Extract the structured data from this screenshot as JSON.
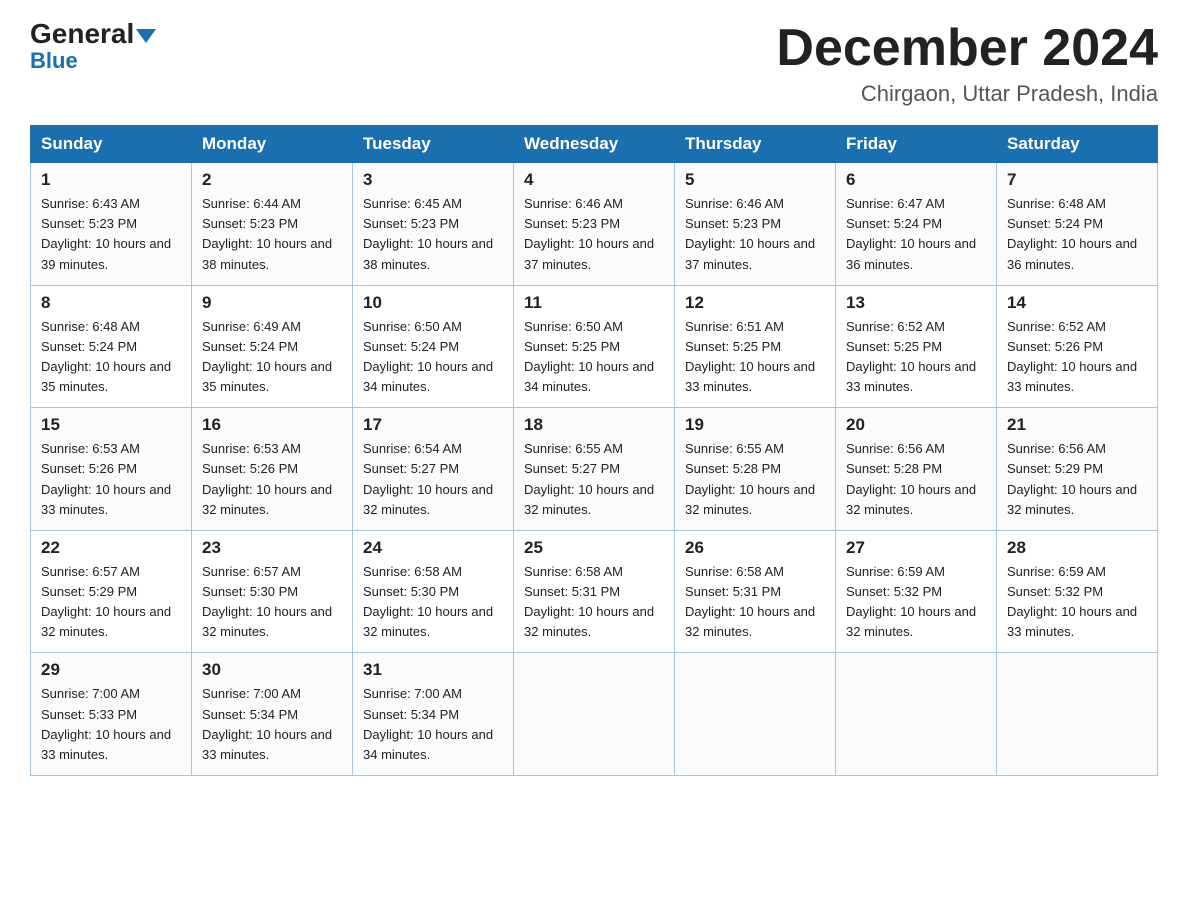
{
  "header": {
    "logo_general": "General",
    "logo_blue": "Blue",
    "month_title": "December 2024",
    "location": "Chirgaon, Uttar Pradesh, India"
  },
  "weekdays": [
    "Sunday",
    "Monday",
    "Tuesday",
    "Wednesday",
    "Thursday",
    "Friday",
    "Saturday"
  ],
  "weeks": [
    [
      {
        "day": "1",
        "sunrise": "6:43 AM",
        "sunset": "5:23 PM",
        "daylight": "10 hours and 39 minutes."
      },
      {
        "day": "2",
        "sunrise": "6:44 AM",
        "sunset": "5:23 PM",
        "daylight": "10 hours and 38 minutes."
      },
      {
        "day": "3",
        "sunrise": "6:45 AM",
        "sunset": "5:23 PM",
        "daylight": "10 hours and 38 minutes."
      },
      {
        "day": "4",
        "sunrise": "6:46 AM",
        "sunset": "5:23 PM",
        "daylight": "10 hours and 37 minutes."
      },
      {
        "day": "5",
        "sunrise": "6:46 AM",
        "sunset": "5:23 PM",
        "daylight": "10 hours and 37 minutes."
      },
      {
        "day": "6",
        "sunrise": "6:47 AM",
        "sunset": "5:24 PM",
        "daylight": "10 hours and 36 minutes."
      },
      {
        "day": "7",
        "sunrise": "6:48 AM",
        "sunset": "5:24 PM",
        "daylight": "10 hours and 36 minutes."
      }
    ],
    [
      {
        "day": "8",
        "sunrise": "6:48 AM",
        "sunset": "5:24 PM",
        "daylight": "10 hours and 35 minutes."
      },
      {
        "day": "9",
        "sunrise": "6:49 AM",
        "sunset": "5:24 PM",
        "daylight": "10 hours and 35 minutes."
      },
      {
        "day": "10",
        "sunrise": "6:50 AM",
        "sunset": "5:24 PM",
        "daylight": "10 hours and 34 minutes."
      },
      {
        "day": "11",
        "sunrise": "6:50 AM",
        "sunset": "5:25 PM",
        "daylight": "10 hours and 34 minutes."
      },
      {
        "day": "12",
        "sunrise": "6:51 AM",
        "sunset": "5:25 PM",
        "daylight": "10 hours and 33 minutes."
      },
      {
        "day": "13",
        "sunrise": "6:52 AM",
        "sunset": "5:25 PM",
        "daylight": "10 hours and 33 minutes."
      },
      {
        "day": "14",
        "sunrise": "6:52 AM",
        "sunset": "5:26 PM",
        "daylight": "10 hours and 33 minutes."
      }
    ],
    [
      {
        "day": "15",
        "sunrise": "6:53 AM",
        "sunset": "5:26 PM",
        "daylight": "10 hours and 33 minutes."
      },
      {
        "day": "16",
        "sunrise": "6:53 AM",
        "sunset": "5:26 PM",
        "daylight": "10 hours and 32 minutes."
      },
      {
        "day": "17",
        "sunrise": "6:54 AM",
        "sunset": "5:27 PM",
        "daylight": "10 hours and 32 minutes."
      },
      {
        "day": "18",
        "sunrise": "6:55 AM",
        "sunset": "5:27 PM",
        "daylight": "10 hours and 32 minutes."
      },
      {
        "day": "19",
        "sunrise": "6:55 AM",
        "sunset": "5:28 PM",
        "daylight": "10 hours and 32 minutes."
      },
      {
        "day": "20",
        "sunrise": "6:56 AM",
        "sunset": "5:28 PM",
        "daylight": "10 hours and 32 minutes."
      },
      {
        "day": "21",
        "sunrise": "6:56 AM",
        "sunset": "5:29 PM",
        "daylight": "10 hours and 32 minutes."
      }
    ],
    [
      {
        "day": "22",
        "sunrise": "6:57 AM",
        "sunset": "5:29 PM",
        "daylight": "10 hours and 32 minutes."
      },
      {
        "day": "23",
        "sunrise": "6:57 AM",
        "sunset": "5:30 PM",
        "daylight": "10 hours and 32 minutes."
      },
      {
        "day": "24",
        "sunrise": "6:58 AM",
        "sunset": "5:30 PM",
        "daylight": "10 hours and 32 minutes."
      },
      {
        "day": "25",
        "sunrise": "6:58 AM",
        "sunset": "5:31 PM",
        "daylight": "10 hours and 32 minutes."
      },
      {
        "day": "26",
        "sunrise": "6:58 AM",
        "sunset": "5:31 PM",
        "daylight": "10 hours and 32 minutes."
      },
      {
        "day": "27",
        "sunrise": "6:59 AM",
        "sunset": "5:32 PM",
        "daylight": "10 hours and 32 minutes."
      },
      {
        "day": "28",
        "sunrise": "6:59 AM",
        "sunset": "5:32 PM",
        "daylight": "10 hours and 33 minutes."
      }
    ],
    [
      {
        "day": "29",
        "sunrise": "7:00 AM",
        "sunset": "5:33 PM",
        "daylight": "10 hours and 33 minutes."
      },
      {
        "day": "30",
        "sunrise": "7:00 AM",
        "sunset": "5:34 PM",
        "daylight": "10 hours and 33 minutes."
      },
      {
        "day": "31",
        "sunrise": "7:00 AM",
        "sunset": "5:34 PM",
        "daylight": "10 hours and 34 minutes."
      },
      null,
      null,
      null,
      null
    ]
  ]
}
